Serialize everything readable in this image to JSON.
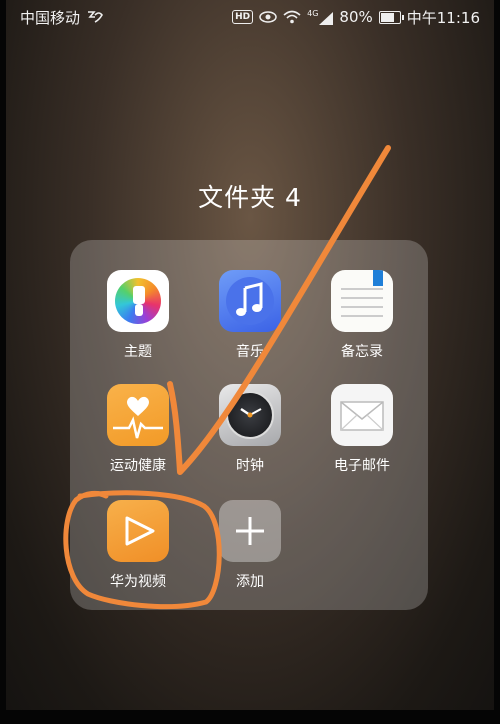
{
  "status_bar": {
    "carrier": "中国移动",
    "signal_label": "4G",
    "battery": "80%",
    "battery_level": 0.8,
    "time": "中午11:16",
    "hd_badge": "HD"
  },
  "folder": {
    "title": "文件夹 4",
    "apps": [
      {
        "label": "主题",
        "icon": "theme-icon"
      },
      {
        "label": "音乐",
        "icon": "music-icon"
      },
      {
        "label": "备忘录",
        "icon": "memo-icon"
      },
      {
        "label": "运动健康",
        "icon": "health-icon"
      },
      {
        "label": "时钟",
        "icon": "clock-icon"
      },
      {
        "label": "电子邮件",
        "icon": "mail-icon"
      },
      {
        "label": "华为视频",
        "icon": "video-icon"
      },
      {
        "label": "添加",
        "icon": "add-icon"
      }
    ]
  },
  "annotation": {
    "color": "#f0883a"
  }
}
